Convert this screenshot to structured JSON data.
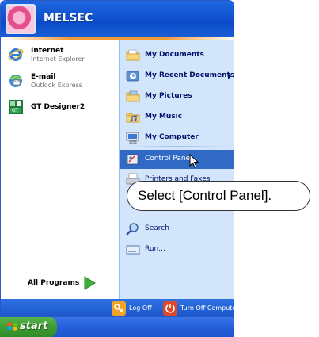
{
  "user": {
    "name": "MELSEC"
  },
  "pinned": [
    {
      "title": "Internet",
      "subtitle": "Internet Explorer",
      "icon": "internet-explorer-icon"
    },
    {
      "title": "E-mail",
      "subtitle": "Outlook Express",
      "icon": "outlook-express-icon"
    },
    {
      "title": "GT Designer2",
      "subtitle": "",
      "icon": "gt-designer-icon"
    }
  ],
  "all_programs": "All Programs",
  "places": {
    "my_documents": "My Documents",
    "my_recent_documents": "My Recent Documents",
    "my_pictures": "My Pictures",
    "my_music": "My Music",
    "my_computer": "My Computer",
    "control_panel": "Control Panel",
    "printers_and_faxes": "Printers and Faxes",
    "search": "Search",
    "run": "Run..."
  },
  "footer": {
    "log_off": "Log Off",
    "turn_off": "Turn Off Computer"
  },
  "taskbar": {
    "start": "start"
  },
  "callout": {
    "text": "Select [Control Panel]."
  },
  "colors": {
    "selection": "#316ac5",
    "header": "#0b4bc9",
    "right_pane": "#d3e5fa",
    "start_green": "#3c9c33"
  }
}
